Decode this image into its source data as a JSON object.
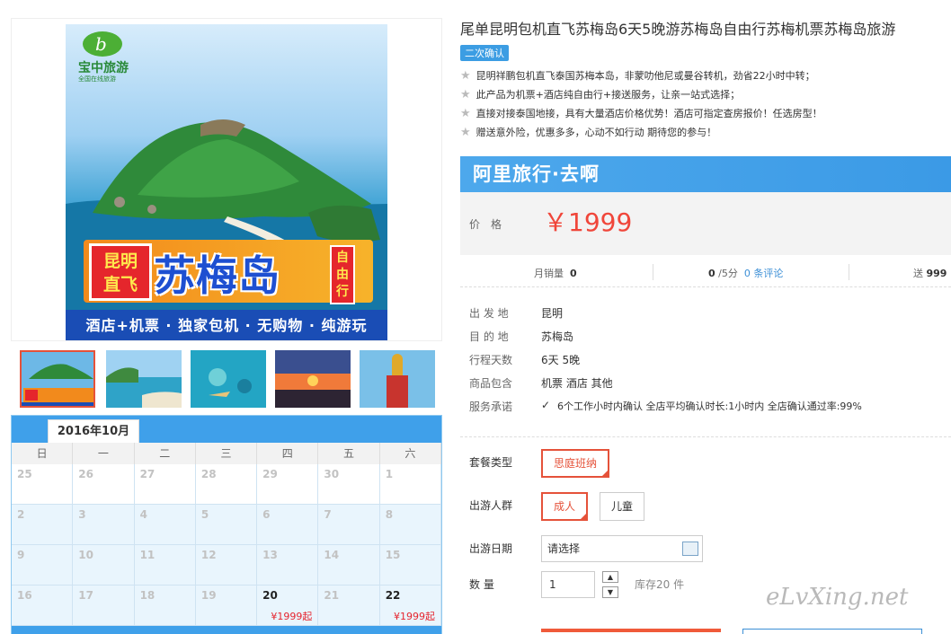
{
  "poster": {
    "logo_text": "宝中旅游",
    "logo_sub": "全国在线旅游",
    "badge_left": "昆明直飞",
    "badge_left_l1": "昆明",
    "badge_left_l2": "直飞",
    "headline": "苏梅岛",
    "badge_right": "自由行",
    "badge_right_stack": "自\n由\n行",
    "strip": "酒店+机票 · 独家包机 · 无购物 · 纯游玩"
  },
  "calendar": {
    "month": "2016年10月",
    "weekdays": [
      "日",
      "一",
      "二",
      "三",
      "四",
      "五",
      "六"
    ],
    "rows": [
      [
        {
          "d": "25"
        },
        {
          "d": "26"
        },
        {
          "d": "27"
        },
        {
          "d": "28"
        },
        {
          "d": "29"
        },
        {
          "d": "30"
        },
        {
          "d": "1"
        }
      ],
      [
        {
          "d": "2"
        },
        {
          "d": "3"
        },
        {
          "d": "4"
        },
        {
          "d": "5"
        },
        {
          "d": "6"
        },
        {
          "d": "7"
        },
        {
          "d": "8"
        }
      ],
      [
        {
          "d": "9"
        },
        {
          "d": "10"
        },
        {
          "d": "11"
        },
        {
          "d": "12"
        },
        {
          "d": "13"
        },
        {
          "d": "14"
        },
        {
          "d": "15"
        }
      ],
      [
        {
          "d": "16"
        },
        {
          "d": "17"
        },
        {
          "d": "18"
        },
        {
          "d": "19"
        },
        {
          "d": "20",
          "price": "¥1999起"
        },
        {
          "d": "21"
        },
        {
          "d": "22",
          "price": "¥1999起"
        }
      ]
    ]
  },
  "product": {
    "title": "尾单昆明包机直飞苏梅岛6天5晚游苏梅岛自由行苏梅机票苏梅岛旅游",
    "confirm_badge": "二次确认",
    "features": [
      "昆明祥鹏包机直飞泰国苏梅本岛，非蒙叻他尼或曼谷转机，劲省22小时中转；",
      "此产品为机票+酒店纯自由行+接送服务，让亲一站式选择；",
      "直接对接泰国地接，具有大量酒店价格优势！酒店可指定查房报价！任选房型！",
      "赠送意外险，优惠多多，心动不如行动 期待您的参与！"
    ],
    "brand": "阿里旅行·去啊",
    "price_label": "价格",
    "price": "￥1999"
  },
  "stats": {
    "monthly_label": "月销量",
    "monthly_value": "0",
    "rating_value": "0",
    "rating_suffix": "/5分",
    "reviews": "0 条评论",
    "points_label": "送",
    "points_value": "999"
  },
  "info": [
    {
      "k": "出 发 地",
      "v": "昆明"
    },
    {
      "k": "目 的 地",
      "v": "苏梅岛"
    },
    {
      "k": "行程天数",
      "v": "6天 5晚"
    },
    {
      "k": "商品包含",
      "v": "机票   酒店   其他"
    },
    {
      "k": "服务承诺",
      "v": "6个工作小时内确认     全店平均确认时长:1小时内     全店确认通过率:99%"
    }
  ],
  "options": {
    "package_label": "套餐类型",
    "package_value": "思庭班纳",
    "crowd_label": "出游人群",
    "crowd_adult": "成人",
    "crowd_child": "儿童",
    "date_label": "出游日期",
    "date_placeholder": "请选择",
    "qty_label": "数    量",
    "qty_value": "1",
    "stock": "库存20 件"
  },
  "watermark": "eLvXing.net"
}
